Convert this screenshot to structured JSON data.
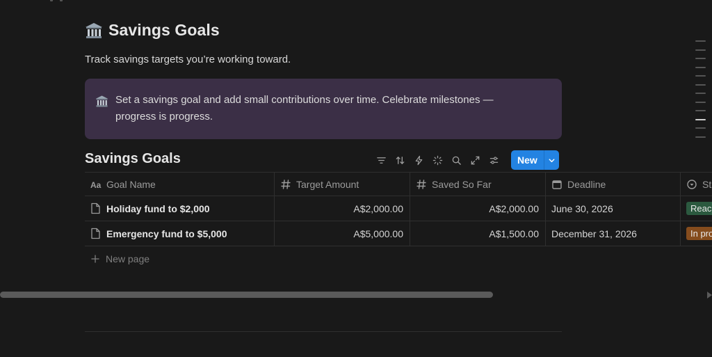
{
  "page": {
    "title": "Savings Goals",
    "title_icon": "bank-icon",
    "description": "Track savings targets you’re working toward."
  },
  "callout": {
    "icon": "bank-icon",
    "text": "Set a savings goal and add small contributions over time. Celebrate milestones — progress is progress.",
    "background": "#3b2f46"
  },
  "database": {
    "title": "Savings Goals",
    "new_button_label": "New",
    "toolbar_icons": [
      "filter-icon",
      "sort-icon",
      "automation-icon",
      "ai-sparkle-icon",
      "search-icon",
      "expand-icon",
      "settings-sliders-icon"
    ],
    "columns": [
      {
        "label": "Goal Name",
        "icon": "text-aa-icon"
      },
      {
        "label": "Target Amount",
        "icon": "hash-icon"
      },
      {
        "label": "Saved So Far",
        "icon": "hash-icon"
      },
      {
        "label": "Deadline",
        "icon": "calendar-icon"
      },
      {
        "label": "Sta",
        "icon": "status-circle-icon"
      }
    ],
    "rows": [
      {
        "name": "Holiday fund to $2,000",
        "target": "A$2,000.00",
        "saved": "A$2,000.00",
        "deadline": "June 30, 2026",
        "status": "Reach",
        "status_color": "#2b593f"
      },
      {
        "name": "Emergency fund to $5,000",
        "target": "A$5,000.00",
        "saved": "A$1,500.00",
        "deadline": "December 31, 2026",
        "status": "In pro",
        "status_color": "#854c1d"
      }
    ],
    "new_page_label": "New page"
  },
  "colors": {
    "background": "#191919",
    "accent": "#2383e2"
  }
}
